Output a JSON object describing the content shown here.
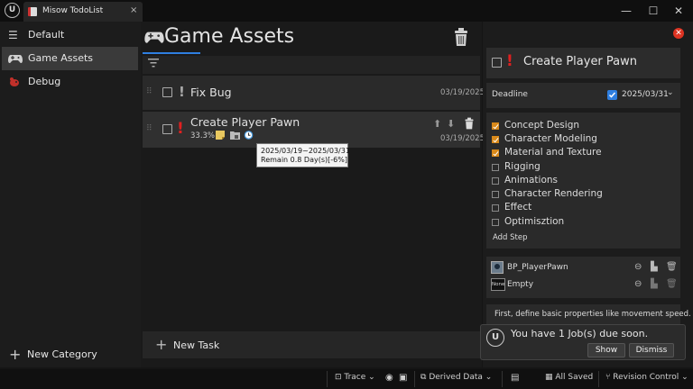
{
  "window": {
    "tab_title": "Misow TodoList",
    "tab_close": "×",
    "minimize": "—",
    "maximize": "☐",
    "close": "✕"
  },
  "sidebar": {
    "items": [
      {
        "label": "Default",
        "icon": "hamburger-icon"
      },
      {
        "label": "Game Assets",
        "icon": "gamepad-icon",
        "active": true
      },
      {
        "label": "Debug",
        "icon": "bug-icon"
      }
    ],
    "new_category": "New Category"
  },
  "main": {
    "title": "Game Assets",
    "tasks": [
      {
        "title": "Fix Bug",
        "date": "03/19/2025",
        "priority": "!"
      },
      {
        "title": "Create Player Pawn",
        "date": "03/19/2025",
        "priority": "!",
        "progress": "33.3%"
      }
    ],
    "new_task": "New Task",
    "tooltip": {
      "range": "2025/03/19~2025/03/31",
      "remain": "Remain 0.8 Day(s)[-6%]"
    }
  },
  "detail": {
    "title": "Create Player Pawn",
    "priority": "!",
    "deadline_label": "Deadline",
    "deadline_value": "2025/03/31",
    "steps": [
      {
        "label": "Concept Design",
        "done": true
      },
      {
        "label": "Character Modeling",
        "done": true
      },
      {
        "label": "Material and Texture",
        "done": true
      },
      {
        "label": "Rigging",
        "done": false
      },
      {
        "label": "Animations",
        "done": false
      },
      {
        "label": "Character Rendering",
        "done": false
      },
      {
        "label": "Effect",
        "done": false
      },
      {
        "label": "Optimisztion",
        "done": false
      }
    ],
    "add_step": "Add Step",
    "assets": [
      {
        "name": "BP_PlayerPawn",
        "thumb": ""
      },
      {
        "name": "Empty",
        "thumb": "None"
      }
    ],
    "description": "First, define basic properties like movement speed."
  },
  "notification": {
    "text": "You have 1 Job(s) due soon.",
    "show": "Show",
    "dismiss": "Dismiss"
  },
  "statusbar": {
    "trace": "Trace",
    "derived_data": "Derived Data",
    "all_saved": "All Saved",
    "revision_control": "Revision Control"
  },
  "colors": {
    "accent_blue": "#2f7fe0",
    "priority_red": "#e02020",
    "check_orange": "#d9891a"
  }
}
